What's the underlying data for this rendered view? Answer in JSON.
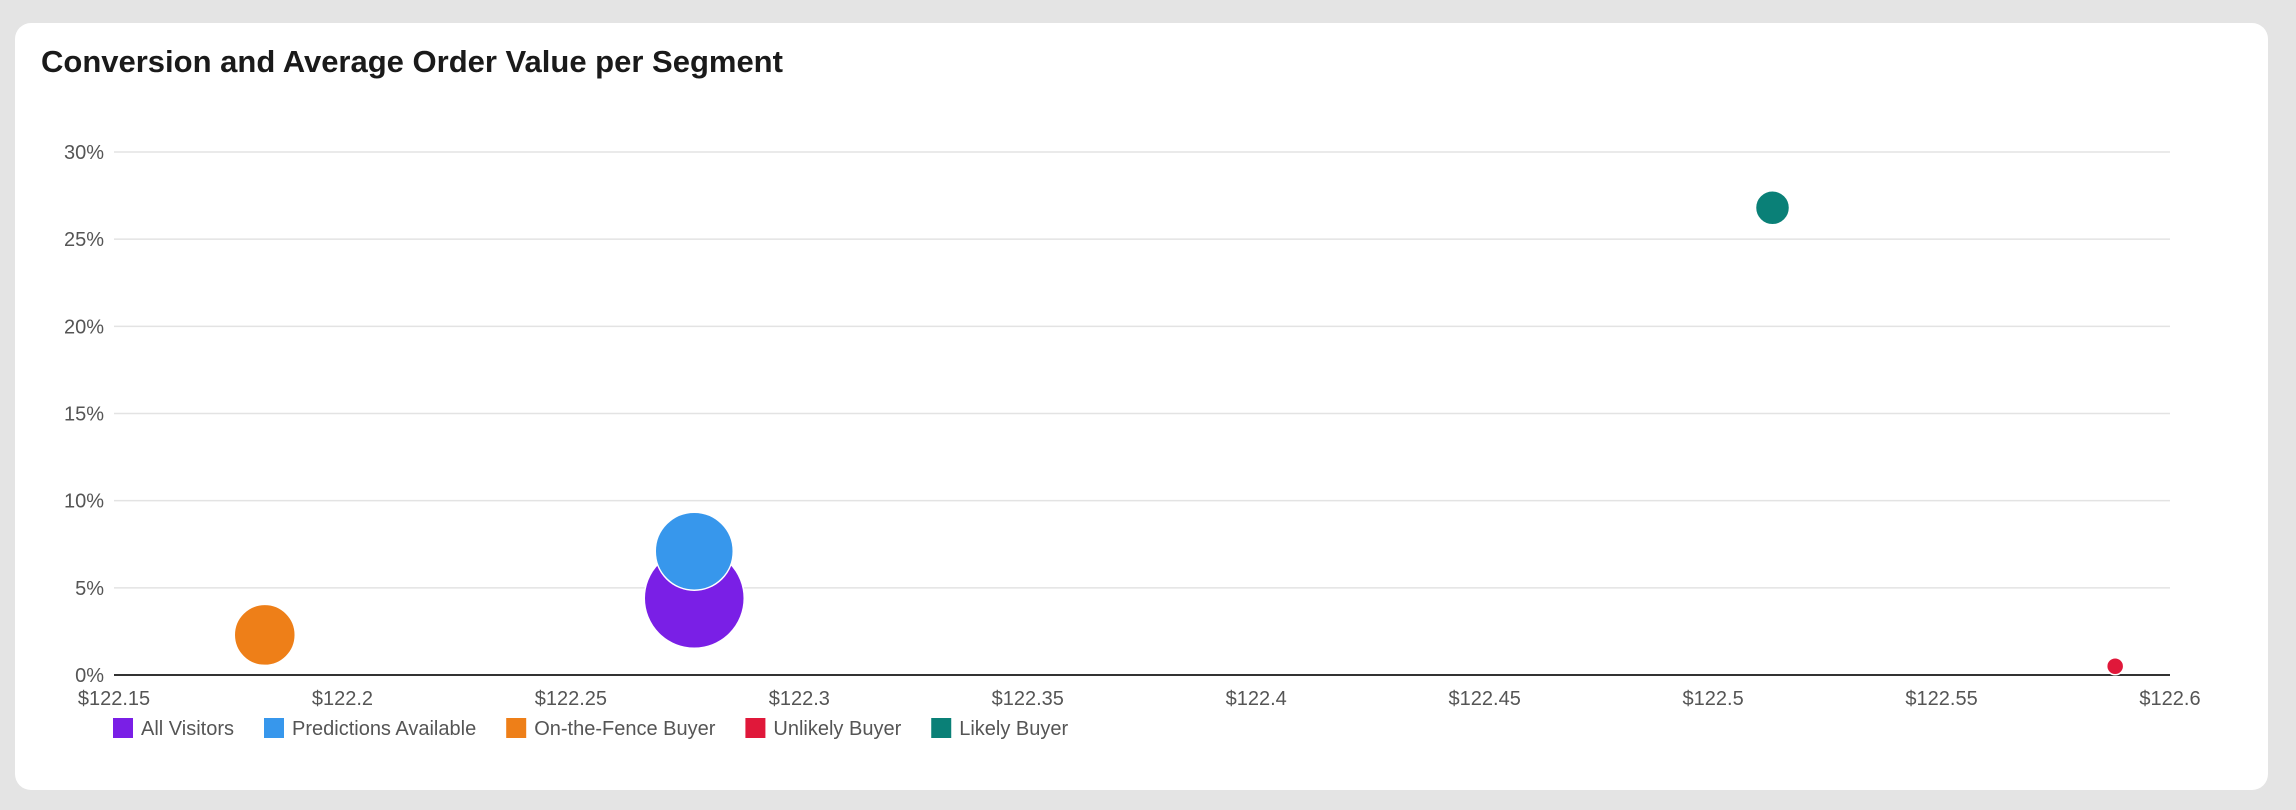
{
  "chart_data": {
    "type": "scatter",
    "title": "Conversion and Average Order Value per Segment",
    "xlabel": "",
    "ylabel": "",
    "xlim": [
      122.15,
      122.6
    ],
    "ylim": [
      0,
      30
    ],
    "x_ticks": [
      "$122.15",
      "$122.2",
      "$122.25",
      "$122.3",
      "$122.35",
      "$122.4",
      "$122.45",
      "$122.5",
      "$122.55",
      "$122.6"
    ],
    "x_tick_values": [
      122.15,
      122.2,
      122.25,
      122.3,
      122.35,
      122.4,
      122.45,
      122.5,
      122.55,
      122.6
    ],
    "y_ticks": [
      "0%",
      "5%",
      "10%",
      "15%",
      "20%",
      "25%",
      "30%"
    ],
    "y_tick_values": [
      0,
      5,
      10,
      15,
      20,
      25,
      30
    ],
    "grid": true,
    "legend_position": "bottom-left",
    "series": [
      {
        "name": "All Visitors",
        "color": "#7a1fe6",
        "x": 122.277,
        "y": 4.4,
        "size": 1.0
      },
      {
        "name": "Predictions Available",
        "color": "#3797ec",
        "x": 122.277,
        "y": 7.1,
        "size": 0.78
      },
      {
        "name": "On-the-Fence Buyer",
        "color": "#ee7f18",
        "x": 122.183,
        "y": 2.3,
        "size": 0.61
      },
      {
        "name": "Unlikely Buyer",
        "color": "#e0183a",
        "x": 122.588,
        "y": 0.5,
        "size": 0.17
      },
      {
        "name": "Likely Buyer",
        "color": "#0a8077",
        "x": 122.513,
        "y": 26.8,
        "size": 0.34
      }
    ]
  }
}
